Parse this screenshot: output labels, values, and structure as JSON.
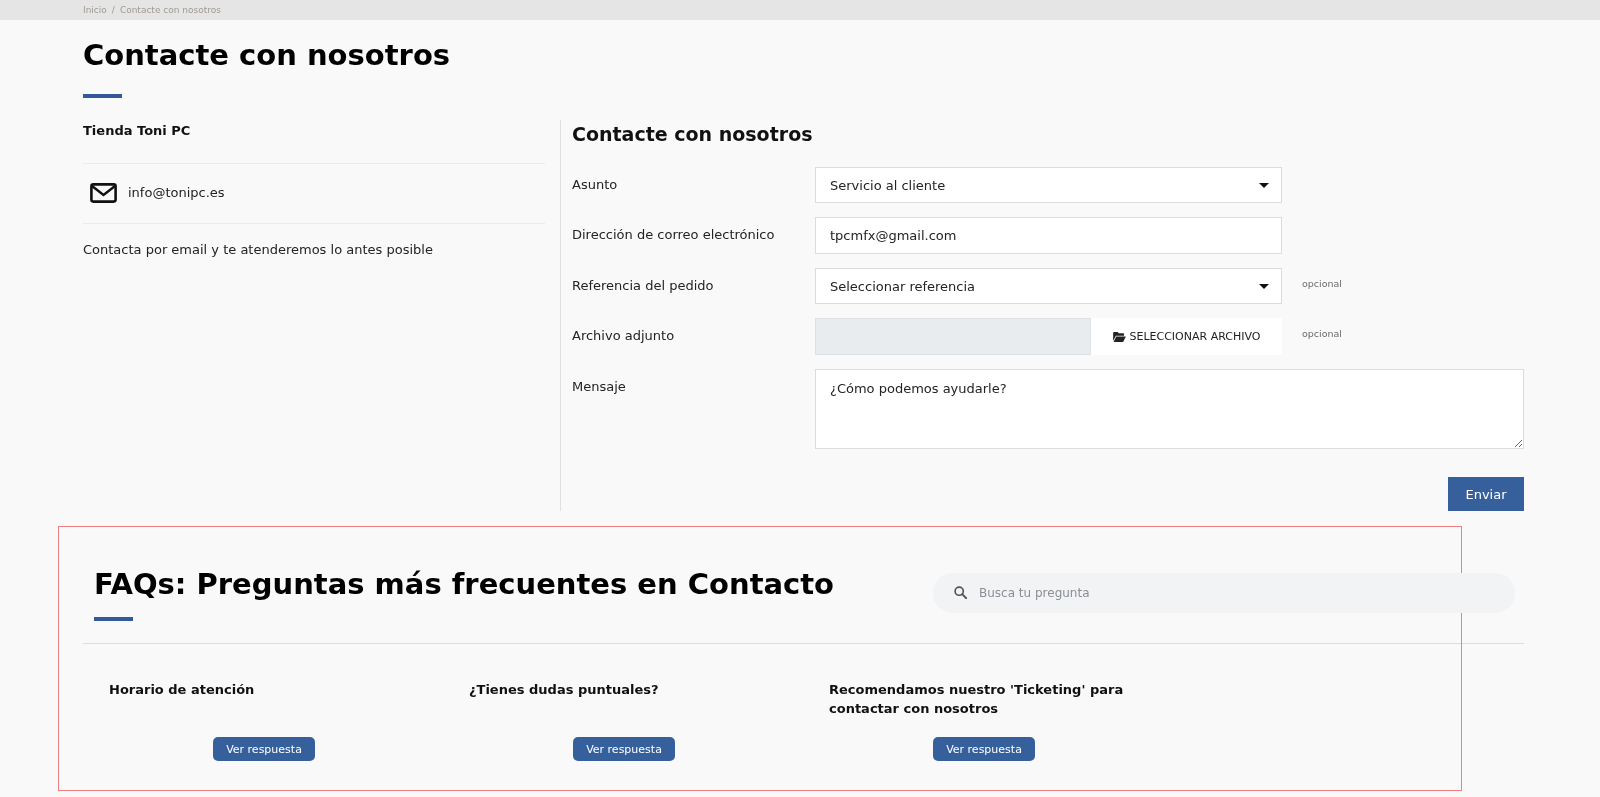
{
  "breadcrumb": {
    "items": [
      {
        "label": "Inicio"
      },
      {
        "label": "Contacte con nosotros"
      }
    ],
    "separator": "/"
  },
  "page_title": "Contacte con nosotros",
  "store": {
    "name": "Tienda Toni PC",
    "email": "info@tonipc.es",
    "note": "Contacta por email y te atenderemos lo antes posible"
  },
  "form": {
    "title": "Contacte con nosotros",
    "fields": [
      {
        "kind": "select",
        "label": "Asunto",
        "value": "Servicio al cliente"
      },
      {
        "kind": "text",
        "label": "Dirección de correo electrónico",
        "value": "tpcmfx@gmail.com"
      },
      {
        "kind": "select",
        "label": "Referencia del pedido",
        "value": "Seleccionar referencia",
        "hint": "opcional"
      },
      {
        "kind": "file",
        "label": "Archivo adjunto",
        "button": "SELECCIONAR ARCHIVO",
        "hint": "opcional"
      },
      {
        "kind": "textarea",
        "label": "Mensaje",
        "placeholder": "¿Cómo podemos ayudarle?"
      }
    ],
    "submit": "Enviar"
  },
  "faq": {
    "highlighted": true,
    "title": "FAQs: Preguntas más frecuentes en Contacto",
    "search": {
      "placeholder": "Busca tu pregunta"
    },
    "questions": [
      {
        "title": "Horario de atención",
        "button": "Ver respuesta"
      },
      {
        "title": "¿Tienes dudas puntuales?",
        "button": "Ver respuesta"
      },
      {
        "title": "Recomendamos nuestro 'Ticketing' para contactar con nosotros",
        "button": "Ver respuesta"
      }
    ]
  }
}
